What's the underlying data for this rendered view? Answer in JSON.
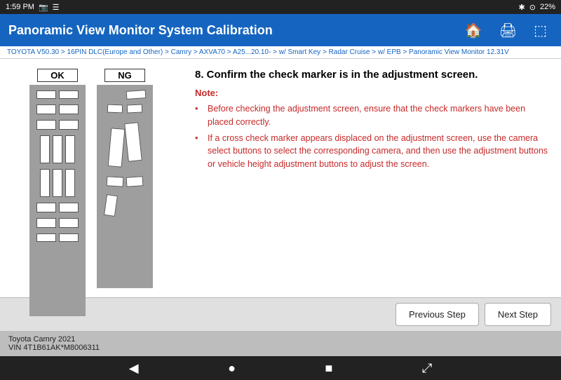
{
  "statusBar": {
    "time": "1:59 PM",
    "battery": "22%"
  },
  "header": {
    "title": "Panoramic View Monitor System Calibration",
    "homeLabel": "🏠",
    "printLabel": "🖨",
    "exitLabel": "⬚"
  },
  "breadcrumb": {
    "text": "TOYOTA V50.30 > 16PIN DLC(Europe and Other) > Camry > AXVA70 > A25...20.10- > w/ Smart Key > Radar Cruise > w/ EPB > Panoramic View Monitor  12.31V"
  },
  "diagram": {
    "okLabel": "OK",
    "ngLabel": "NG"
  },
  "instructions": {
    "stepTitle": "8. Confirm the check marker is in the adjustment screen.",
    "noteLabel": "Note:",
    "bullets": [
      "Before checking the adjustment screen, ensure that the check markers have been placed correctly.",
      "If a cross check marker appears displaced on the adjustment screen, use the camera select buttons to select the corresponding camera, and then use the adjustment buttons or vehicle height adjustment buttons to adjust the screen."
    ]
  },
  "navigation": {
    "prevLabel": "Previous Step",
    "nextLabel": "Next Step"
  },
  "footer": {
    "carModel": "Toyota Camry 2021",
    "vin": "VIN 4T1B61AK*M8006311"
  },
  "navBar": {
    "backLabel": "◀",
    "homeLabel": "●",
    "squareLabel": "■",
    "arrowLabel": "⤢"
  }
}
